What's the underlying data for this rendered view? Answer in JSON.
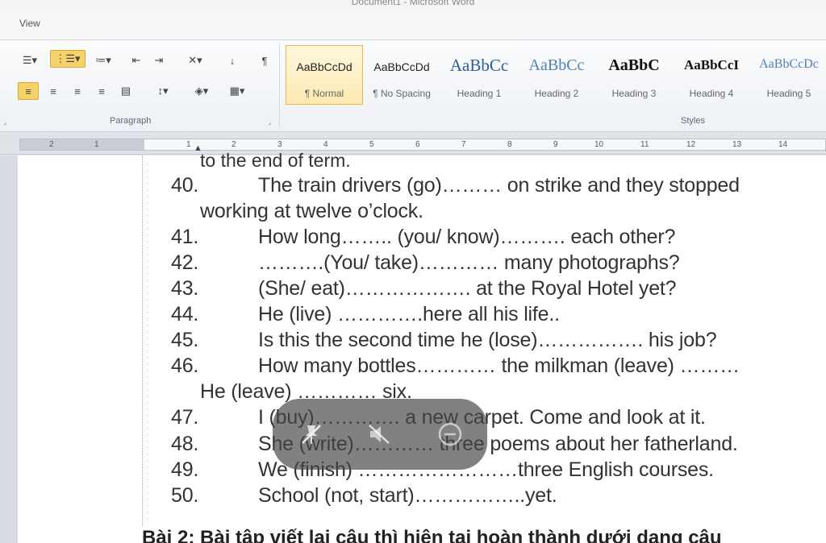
{
  "window": {
    "title": "Document1 - Microsoft Word"
  },
  "tabs": {
    "view": "View"
  },
  "ribbon": {
    "paragraph_label": "Paragraph",
    "styles_label": "Styles",
    "styles": [
      {
        "preview": "AaBbCcDd",
        "name": "¶ Normal",
        "selected": true
      },
      {
        "preview": "AaBbCcDd",
        "name": "¶ No Spacing"
      },
      {
        "preview": "AaBbCc",
        "name": "Heading 1"
      },
      {
        "preview": "AaBbCc",
        "name": "Heading 2"
      },
      {
        "preview": "AaBbC",
        "name": "Heading 3"
      },
      {
        "preview": "AaBbCcI",
        "name": "Heading 4"
      },
      {
        "preview": "AaBbCcDc",
        "name": "Heading 5"
      }
    ]
  },
  "ruler": {
    "labels": [
      "2",
      "1",
      "1",
      "2",
      "3",
      "4",
      "5",
      "6",
      "7",
      "8",
      "9",
      "10",
      "11",
      "12",
      "13",
      "14"
    ]
  },
  "document": {
    "cut_line": "to the end of term.",
    "items": [
      {
        "num": "40.",
        "text": "The train drivers (go)……… on strike and they stopped",
        "cont": "working at twelve o’clock."
      },
      {
        "num": "41.",
        "text": "How long…….. (you/ know)………. each other?"
      },
      {
        "num": "42.",
        "text": "……….(You/ take)………… many photographs?"
      },
      {
        "num": "43.",
        "text": "(She/ eat)………………. at the Royal Hotel yet?"
      },
      {
        "num": "44.",
        "text": "He (live) ………….here all his life.."
      },
      {
        "num": "45.",
        "text": "Is this the second time he (lose)……………. his job?"
      },
      {
        "num": "46.",
        "text": "How many bottles………… the milkman (leave) ………",
        "cont": "He (leave) ………… six."
      },
      {
        "num": "47.",
        "text": "I (buy)…………. a new carpet. Come and look at it."
      },
      {
        "num": "48.",
        "text": "She (write)………… three poems about her fatherland."
      },
      {
        "num": "49.",
        "text": "We (finish) ……………………three English courses."
      },
      {
        "num": "50.",
        "text": "School (not, start)……………..yet."
      }
    ],
    "next_heading": "Bài 2: Bài tập viết lại câu thì hiện tại hoàn thành dưới dạng câu"
  }
}
